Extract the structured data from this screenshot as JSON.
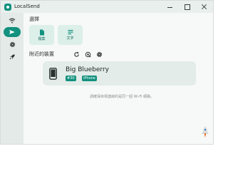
{
  "window": {
    "title": "LocalSend",
    "accent_color": "#12917e"
  },
  "sidebar": {
    "items": [
      {
        "icon": "wifi-icon",
        "active": false
      },
      {
        "icon": "send-icon",
        "active": true
      },
      {
        "icon": "gear-icon",
        "active": false
      },
      {
        "icon": "rocket-icon",
        "active": false
      }
    ]
  },
  "selection": {
    "label": "選擇",
    "buttons": [
      {
        "label": "檔案",
        "icon": "file-icon"
      },
      {
        "label": "文字",
        "icon": "text-icon"
      }
    ]
  },
  "nearby": {
    "label": "附近的裝置",
    "tools": [
      "refresh-icon",
      "target-icon",
      "gear-icon"
    ],
    "device": {
      "name": "Big Blueberry",
      "badges": [
        "#30",
        "iPhone"
      ]
    }
  },
  "hint": "請確保目標連線的是同一個 Wi-Fi 網路。"
}
